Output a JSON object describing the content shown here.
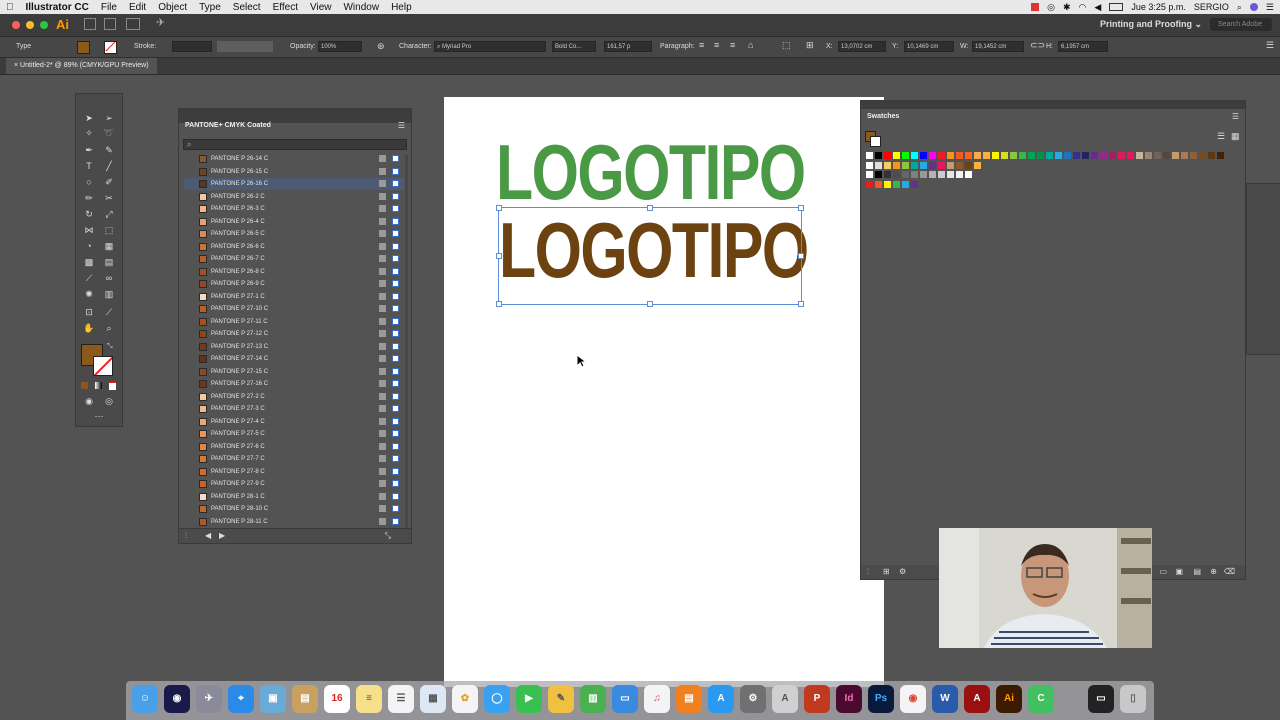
{
  "menubar": {
    "app_name": "Illustrator CC",
    "menus": [
      "File",
      "Edit",
      "Object",
      "Type",
      "Select",
      "Effect",
      "View",
      "Window",
      "Help"
    ],
    "clock": "Jue 3:25 p.m.",
    "user": "SERGIO"
  },
  "appbar": {
    "logo": "Ai",
    "workspace": "Printing and Proofing",
    "search_placeholder": "Search Adobe"
  },
  "controlbar": {
    "tool_label": "Type",
    "stroke_label": "Stroke:",
    "opacity_label": "Opacity:",
    "opacity_value": "100%",
    "character_label": "Character:",
    "font_family": "Myriad Pro",
    "font_style": "Bold Co...",
    "font_size": "161,57 p",
    "paragraph_label": "Paragraph:",
    "x_label": "X:",
    "x_value": "13,0702 cm",
    "y_label": "Y:",
    "y_value": "10,1469 cm",
    "w_label": "W:",
    "w_value": "19,1452 cm",
    "h_label": "H:",
    "h_value": "6,1957 cm"
  },
  "document": {
    "tab_title": "Untitled-2* @ 89% (CMYK/GPU Preview)"
  },
  "canvas": {
    "logo_top": "LOGOTIPO",
    "logo_bottom": "LOGOTIPO",
    "logo_top_color": "#4a9a45",
    "logo_bottom_color": "#6b4210"
  },
  "pantone_panel": {
    "title": "PANTONE+ CMYK Coated",
    "selected_index": 2,
    "items": [
      {
        "name": "PANTONE P 26-14 C",
        "color": "#8a5a2c"
      },
      {
        "name": "PANTONE P 26-15 C",
        "color": "#6e4520"
      },
      {
        "name": "PANTONE P 26-16 C",
        "color": "#5a3818"
      },
      {
        "name": "PANTONE P 26-2 C",
        "color": "#f2c8a4"
      },
      {
        "name": "PANTONE P 26-3 C",
        "color": "#eeb790"
      },
      {
        "name": "PANTONE P 26-4 C",
        "color": "#e6a172"
      },
      {
        "name": "PANTONE P 26-5 C",
        "color": "#d98a55"
      },
      {
        "name": "PANTONE P 26-6 C",
        "color": "#c8743c"
      },
      {
        "name": "PANTONE P 26-7 C",
        "color": "#b5622c"
      },
      {
        "name": "PANTONE P 26-8 C",
        "color": "#a05326"
      },
      {
        "name": "PANTONE P 26-9 C",
        "color": "#8f4a22"
      },
      {
        "name": "PANTONE P 27-1 C",
        "color": "#f6d9bf"
      },
      {
        "name": "PANTONE P 27-10 C",
        "color": "#c25f1f"
      },
      {
        "name": "PANTONE P 27-11 C",
        "color": "#a8501c"
      },
      {
        "name": "PANTONE P 27-12 C",
        "color": "#8e4519"
      },
      {
        "name": "PANTONE P 27-13 C",
        "color": "#773a16"
      },
      {
        "name": "PANTONE P 27-14 C",
        "color": "#653213"
      },
      {
        "name": "PANTONE P 27-15 C",
        "color": "#8a4a24"
      },
      {
        "name": "PANTONE P 27-16 C",
        "color": "#6b3a1c"
      },
      {
        "name": "PANTONE P 27-2 C",
        "color": "#f4caa2"
      },
      {
        "name": "PANTONE P 27-3 C",
        "color": "#f1b98a"
      },
      {
        "name": "PANTONE P 27-4 C",
        "color": "#eea674"
      },
      {
        "name": "PANTONE P 27-5 C",
        "color": "#ea955c"
      },
      {
        "name": "PANTONE P 27-6 C",
        "color": "#e48446"
      },
      {
        "name": "PANTONE P 27-7 C",
        "color": "#dd7534"
      },
      {
        "name": "PANTONE P 27-8 C",
        "color": "#d26a2a"
      },
      {
        "name": "PANTONE P 27-9 C",
        "color": "#c96224"
      },
      {
        "name": "PANTONE P 28-1 C",
        "color": "#f6dcc6"
      },
      {
        "name": "PANTONE P 28-10 C",
        "color": "#c16a2c"
      },
      {
        "name": "PANTONE P 28-11 C",
        "color": "#a75b26"
      }
    ]
  },
  "swatches_panel": {
    "title": "Swatches",
    "row1": [
      "#ffffff",
      "#000000",
      "#ff0000",
      "#ffff00",
      "#00ff00",
      "#00ffff",
      "#0000ff",
      "#ff00ff",
      "#ed1c24",
      "#f7941d",
      "#f15a24",
      "#f26522",
      "#f7ac53",
      "#fbb040",
      "#fff200",
      "#d7df23",
      "#8dc63f",
      "#39b54a",
      "#00a651",
      "#009444",
      "#00a99d",
      "#27aae1",
      "#1c75bc",
      "#2e3192",
      "#262262",
      "#662d91",
      "#92278f",
      "#9e1f63",
      "#da1c5c",
      "#ed145b",
      "#c2b59b",
      "#998675",
      "#736357",
      "#534741",
      "#c69c6d",
      "#a67c52",
      "#8c6239",
      "#754c24",
      "#603813",
      "#42210b"
    ],
    "row2": [
      "#ffffff",
      "#e0e0e0",
      "#f5d060",
      "#f7941d",
      "#8dc63f",
      "#00a99d",
      "#27aae1",
      "#662d91",
      "#ed145b",
      "#c69c6d",
      "#8a5a2c",
      "#6b4210",
      "#fbb040"
    ],
    "row3": [
      "#ffffff",
      "#000000",
      "#333333",
      "#4d4d4d",
      "#666666",
      "#808080",
      "#999999",
      "#b3b3b3",
      "#cccccc",
      "#e6e6e6",
      "#f2f2f2",
      "#ffffff"
    ],
    "row4": [
      "#ed1c24",
      "#f15a24",
      "#fff200",
      "#39b54a",
      "#27aae1",
      "#662d91"
    ]
  },
  "colors": {
    "fill_color": "#8b5a1a",
    "selection": "#5a8fdc"
  }
}
